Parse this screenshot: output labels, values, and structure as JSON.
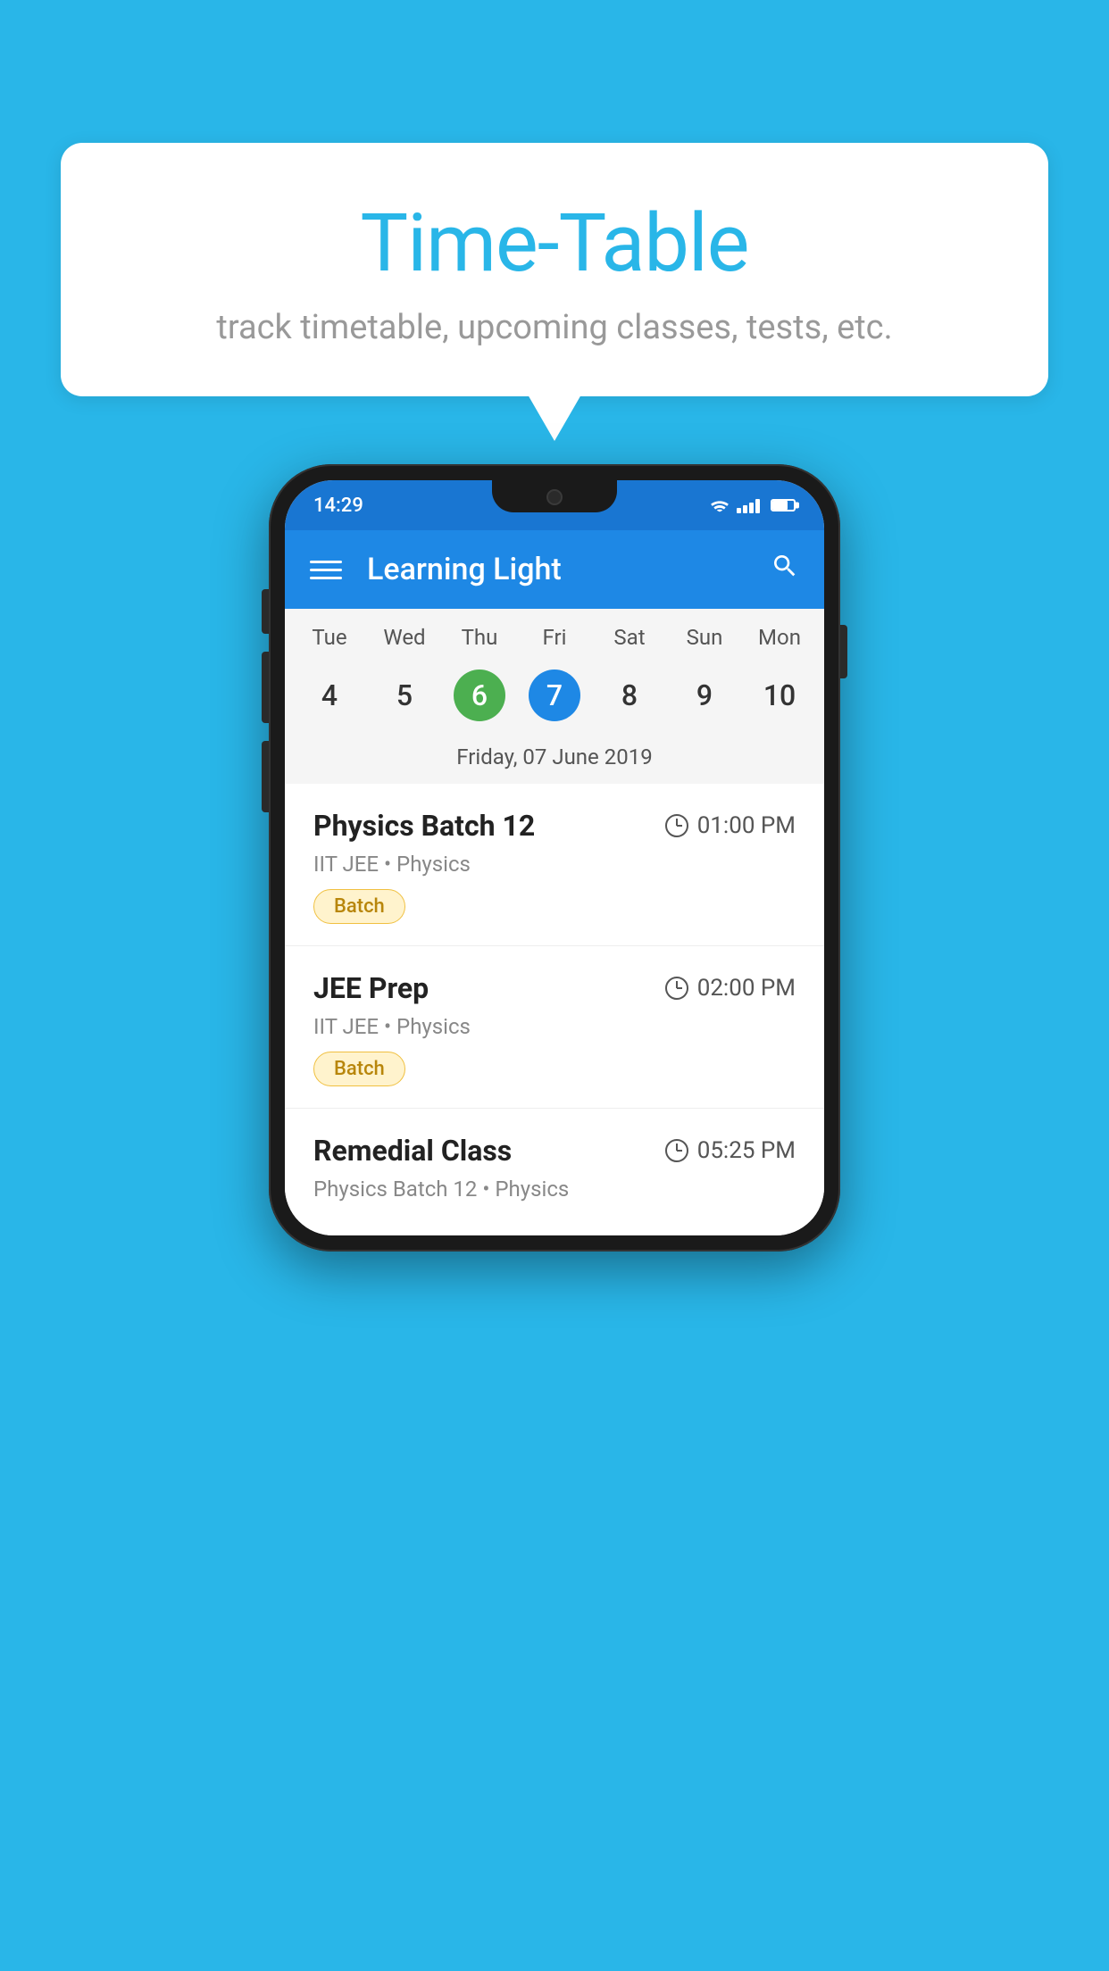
{
  "background_color": "#29B6E8",
  "speech_bubble": {
    "title": "Time-Table",
    "subtitle": "track timetable, upcoming classes, tests, etc."
  },
  "phone": {
    "status_bar": {
      "time": "14:29"
    },
    "app_bar": {
      "title": "Learning Light"
    },
    "calendar": {
      "day_names": [
        "Tue",
        "Wed",
        "Thu",
        "Fri",
        "Sat",
        "Sun",
        "Mon"
      ],
      "dates": [
        {
          "num": "4",
          "state": "normal"
        },
        {
          "num": "5",
          "state": "normal"
        },
        {
          "num": "6",
          "state": "today"
        },
        {
          "num": "7",
          "state": "selected"
        },
        {
          "num": "8",
          "state": "normal"
        },
        {
          "num": "9",
          "state": "normal"
        },
        {
          "num": "10",
          "state": "normal"
        }
      ],
      "selected_date_label": "Friday, 07 June 2019"
    },
    "classes": [
      {
        "name": "Physics Batch 12",
        "time": "01:00 PM",
        "subtitle": "IIT JEE • Physics",
        "tag": "Batch"
      },
      {
        "name": "JEE Prep",
        "time": "02:00 PM",
        "subtitle": "IIT JEE • Physics",
        "tag": "Batch"
      },
      {
        "name": "Remedial Class",
        "time": "05:25 PM",
        "subtitle": "Physics Batch 12 • Physics",
        "tag": ""
      }
    ]
  }
}
